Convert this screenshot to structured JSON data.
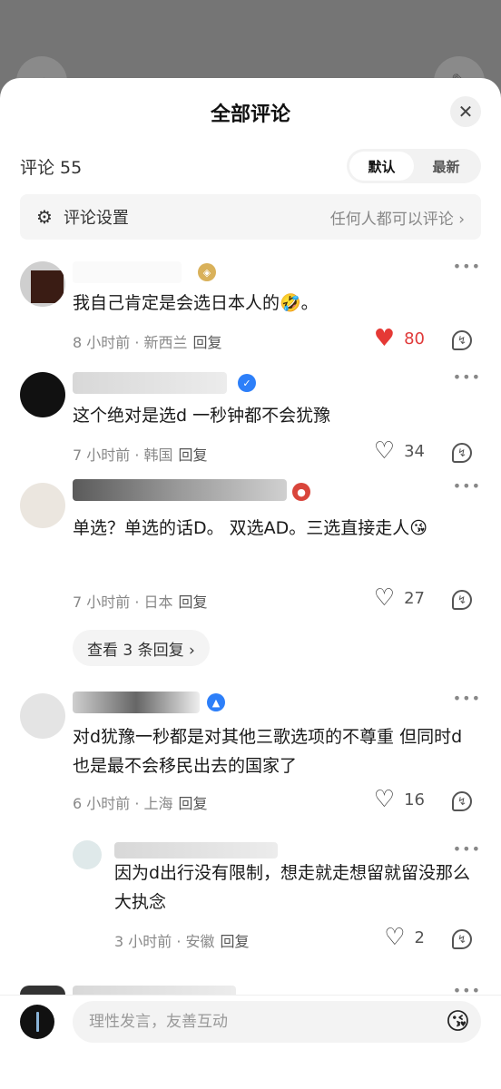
{
  "header": {
    "title": "全部评论",
    "close_label": "✕"
  },
  "comment_count_label": "评论 55",
  "sort": {
    "options": [
      "默认",
      "最新"
    ],
    "selected": "默认"
  },
  "settings": {
    "label": "评论设置",
    "value": "任何人都可以评论 ›"
  },
  "comments": [
    {
      "text": "我自己肯定是会选日本人的🤣。",
      "time": "8 小时前 · 新西兰",
      "reply_label": "回复",
      "likes": "80",
      "liked": true
    },
    {
      "text": "这个绝对是选d 一秒钟都不会犹豫",
      "time": "7 小时前 · 韩国",
      "reply_label": "回复",
      "likes": "34",
      "liked": false
    },
    {
      "text": "单选？单选的话D。 双选AD。三选直接走人😘",
      "time": "7 小时前 · 日本",
      "reply_label": "回复",
      "likes": "27",
      "liked": false,
      "view_replies": "查看 3 条回复 ›"
    },
    {
      "text": "对d犹豫一秒都是对其他三歌选项的不尊重 但同时d也是最不会移民出去的国家了",
      "time": "6 小时前 · 上海",
      "reply_label": "回复",
      "likes": "16",
      "liked": false
    },
    {
      "text": "因为d出行没有限制，想走就走想留就留没那么大执念",
      "time": "3 小时前 · 安徽",
      "reply_label": "回复",
      "likes": "2",
      "liked": false,
      "is_reply": true
    }
  ],
  "composer": {
    "placeholder": "理性发言，友善互动",
    "emoji_icon": "emoji-face"
  },
  "colors": {
    "accent_like": "#e53935",
    "verified_blue": "#2d7ff9",
    "badge_red": "#d9453b",
    "badge_gold": "#d9b15a"
  }
}
